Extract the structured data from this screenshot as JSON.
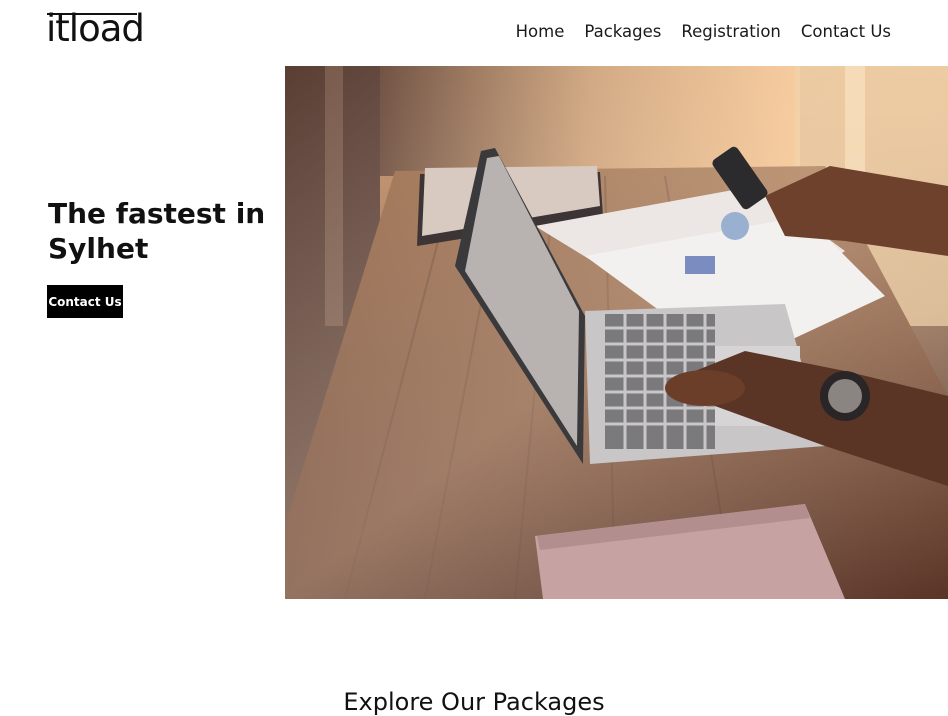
{
  "header": {
    "logo_text": "itload",
    "nav": [
      "Home",
      "Packages",
      "Registration",
      "Contact Us"
    ]
  },
  "hero": {
    "title": "The fastest in Sylhet",
    "cta_label": "Contact Us"
  },
  "packages": {
    "title": "Explore Our Packages"
  }
}
